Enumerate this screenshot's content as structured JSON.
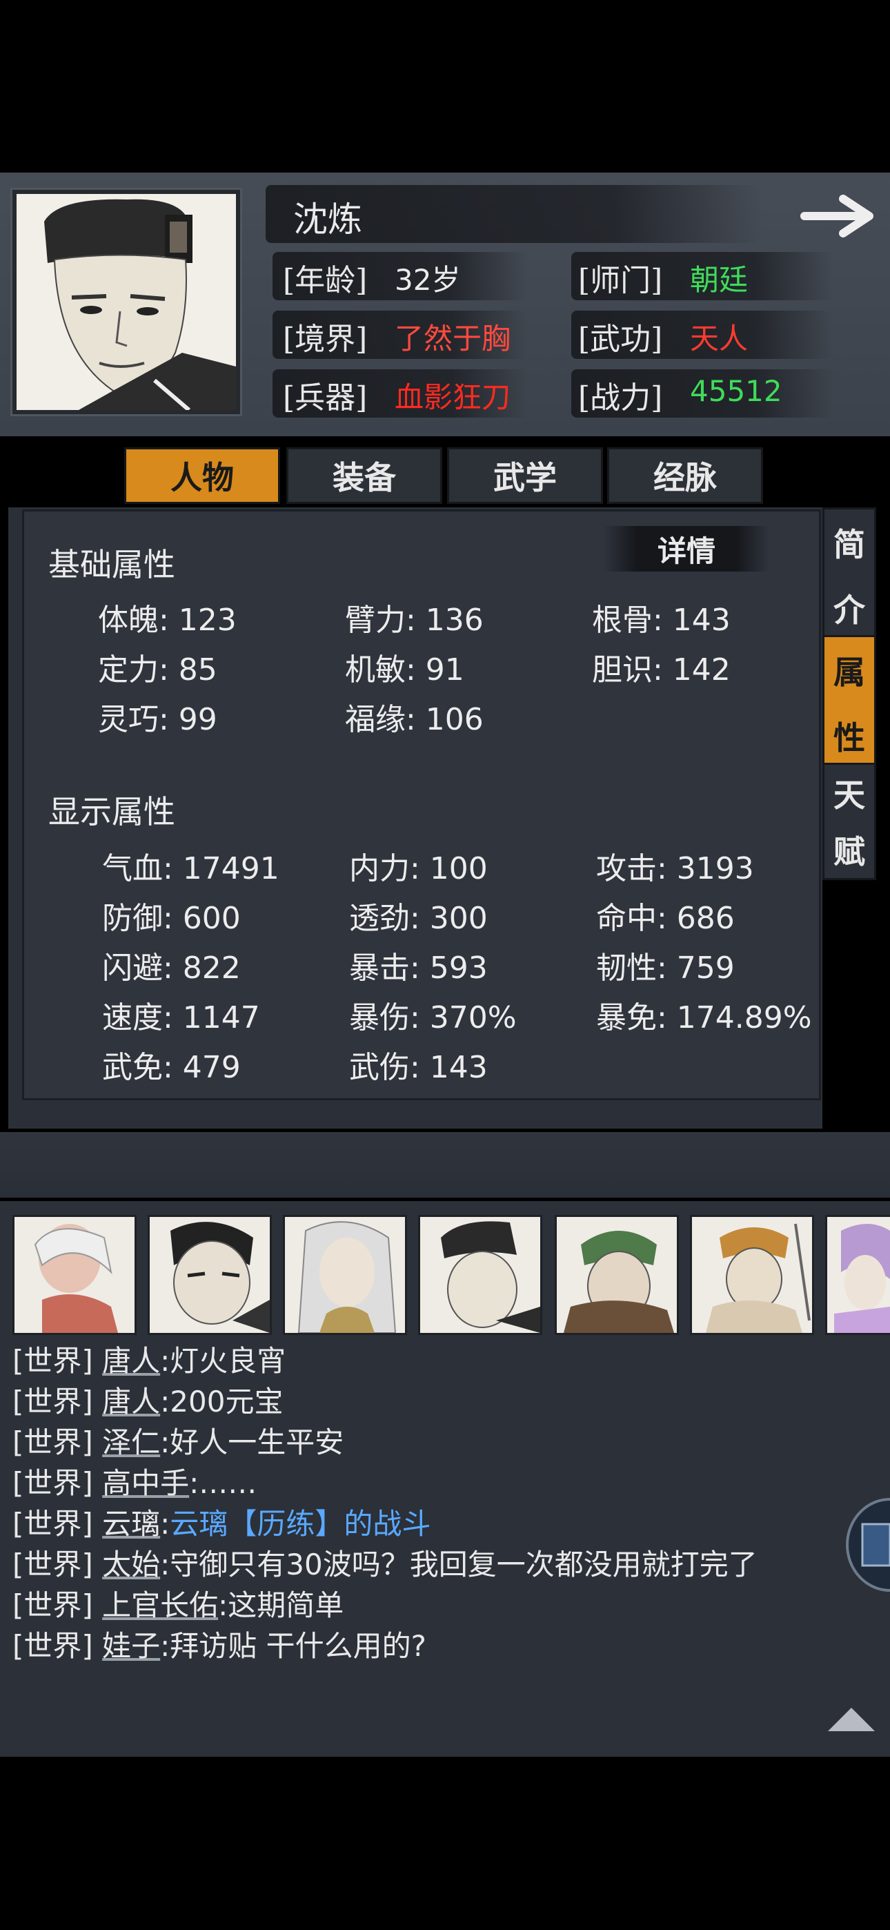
{
  "character": {
    "name": "沈炼",
    "age_label": "[年龄]",
    "age": "32岁",
    "sect_label": "[师门]",
    "sect": "朝廷",
    "realm_label": "[境界]",
    "realm": "了然于胸",
    "martial_label": "[武功]",
    "martial": "天人",
    "weapon_label": "[兵器]",
    "weapon": "血影狂刀",
    "power_label": "[战力]",
    "power": "45512"
  },
  "colors": {
    "green": "#3fdc5a",
    "red": "#ff3b30",
    "orange": "#d88a1c",
    "link_blue": "#5aa9ff"
  },
  "tabs": [
    "人物",
    "装备",
    "武学",
    "经脉"
  ],
  "side_tabs": [
    {
      "c1": "简",
      "c2": "介"
    },
    {
      "c1": "属",
      "c2": "性"
    },
    {
      "c1": "天",
      "c2": "赋"
    }
  ],
  "detail_button": "详情",
  "basic_title": "基础属性",
  "basic": [
    [
      "体魄: 123",
      "臂力: 136",
      "根骨: 143"
    ],
    [
      "定力: 85",
      "机敏: 91",
      "胆识: 142"
    ],
    [
      "灵巧: 99",
      "福缘: 106",
      ""
    ]
  ],
  "display_title": "显示属性",
  "display": [
    [
      "气血: 17491",
      "内力: 100",
      "攻击: 3193"
    ],
    [
      "防御: 600",
      "透劲: 300",
      "命中: 686"
    ],
    [
      "闪避: 822",
      "暴击: 593",
      "韧性: 759"
    ],
    [
      "速度: 1147",
      "暴伤: 370%",
      "暴免: 174.89%"
    ],
    [
      "武免: 479",
      "武伤: 143",
      ""
    ]
  ],
  "chat": [
    {
      "channel": "[世界]",
      "name": "唐人",
      "msg": ":灯火良宵",
      "link": ""
    },
    {
      "channel": "[世界]",
      "name": "唐人",
      "msg": ":200元宝",
      "link": ""
    },
    {
      "channel": "[世界]",
      "name": "泽仁",
      "msg": ":好人一生平安",
      "link": ""
    },
    {
      "channel": "[世界]",
      "name": "高中手",
      "msg": ":……",
      "link": ""
    },
    {
      "channel": "[世界]",
      "name": "云璃",
      "msg": ":",
      "link": "云璃【历练】的战斗"
    },
    {
      "channel": "[世界]",
      "name": "太始",
      "msg": ":守御只有30波吗？我回复一次都没用就打完了",
      "link": ""
    },
    {
      "channel": "[世界]",
      "name": "上官长佑",
      "msg": ":这期简单",
      "link": ""
    },
    {
      "channel": "[世界]",
      "name": "娃子",
      "msg": ":拜访贴 干什么用的?",
      "link": ""
    }
  ]
}
